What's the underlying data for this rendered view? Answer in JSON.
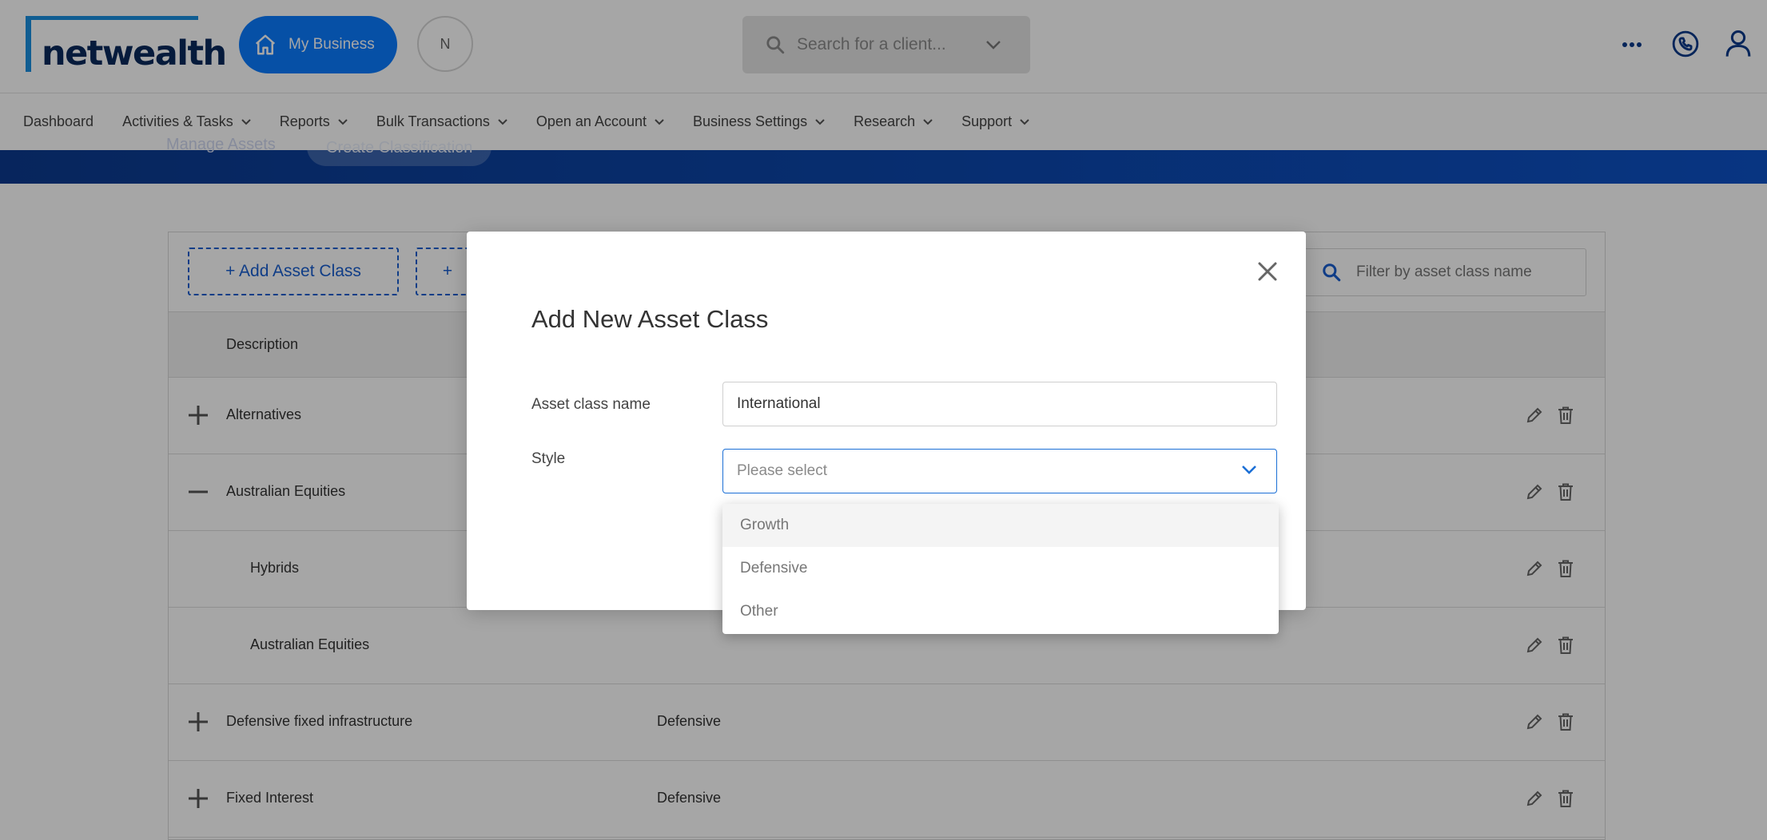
{
  "header": {
    "logo_text": "netwealth",
    "my_business_label": "My Business",
    "avatar_initial": "N",
    "client_search_placeholder": "Search for a client...",
    "icons": [
      "more-icon",
      "phone-icon",
      "user-icon"
    ]
  },
  "nav": {
    "items": [
      {
        "label": "Dashboard",
        "has_caret": false
      },
      {
        "label": "Activities & Tasks",
        "has_caret": true
      },
      {
        "label": "Reports",
        "has_caret": true
      },
      {
        "label": "Bulk Transactions",
        "has_caret": true
      },
      {
        "label": "Open an Account",
        "has_caret": true
      },
      {
        "label": "Business Settings",
        "has_caret": true
      },
      {
        "label": "Research",
        "has_caret": true
      },
      {
        "label": "Support",
        "has_caret": true
      }
    ]
  },
  "banner": {
    "crumb_manage": "Manage Assets",
    "crumb_create": "Create Classification"
  },
  "toolbar": {
    "add_asset_class": "+ Add Asset Class",
    "second_button": "+",
    "filter_placeholder": "Filter by asset class name"
  },
  "table": {
    "header_description": "Description",
    "rows": [
      {
        "name": "Alternatives",
        "style": "",
        "expander": "plus"
      },
      {
        "name": "Australian Equities",
        "style": "",
        "expander": "minus"
      },
      {
        "name": "Hybrids",
        "style": "",
        "expander": "none"
      },
      {
        "name": "Australian Equities",
        "style": "",
        "expander": "none"
      },
      {
        "name": "Defensive fixed infrastructure",
        "style": "Defensive",
        "expander": "plus"
      },
      {
        "name": "Fixed Interest",
        "style": "Defensive",
        "expander": "plus"
      }
    ]
  },
  "modal": {
    "title": "Add New Asset Class",
    "name_label": "Asset class name",
    "name_value": "International",
    "style_label": "Style",
    "style_placeholder": "Please select",
    "options": [
      "Growth",
      "Defensive",
      "Other"
    ]
  },
  "colors": {
    "primary": "#0a7bff",
    "brand_navy": "#0a2a5c",
    "link_blue": "#1a5fd0"
  }
}
